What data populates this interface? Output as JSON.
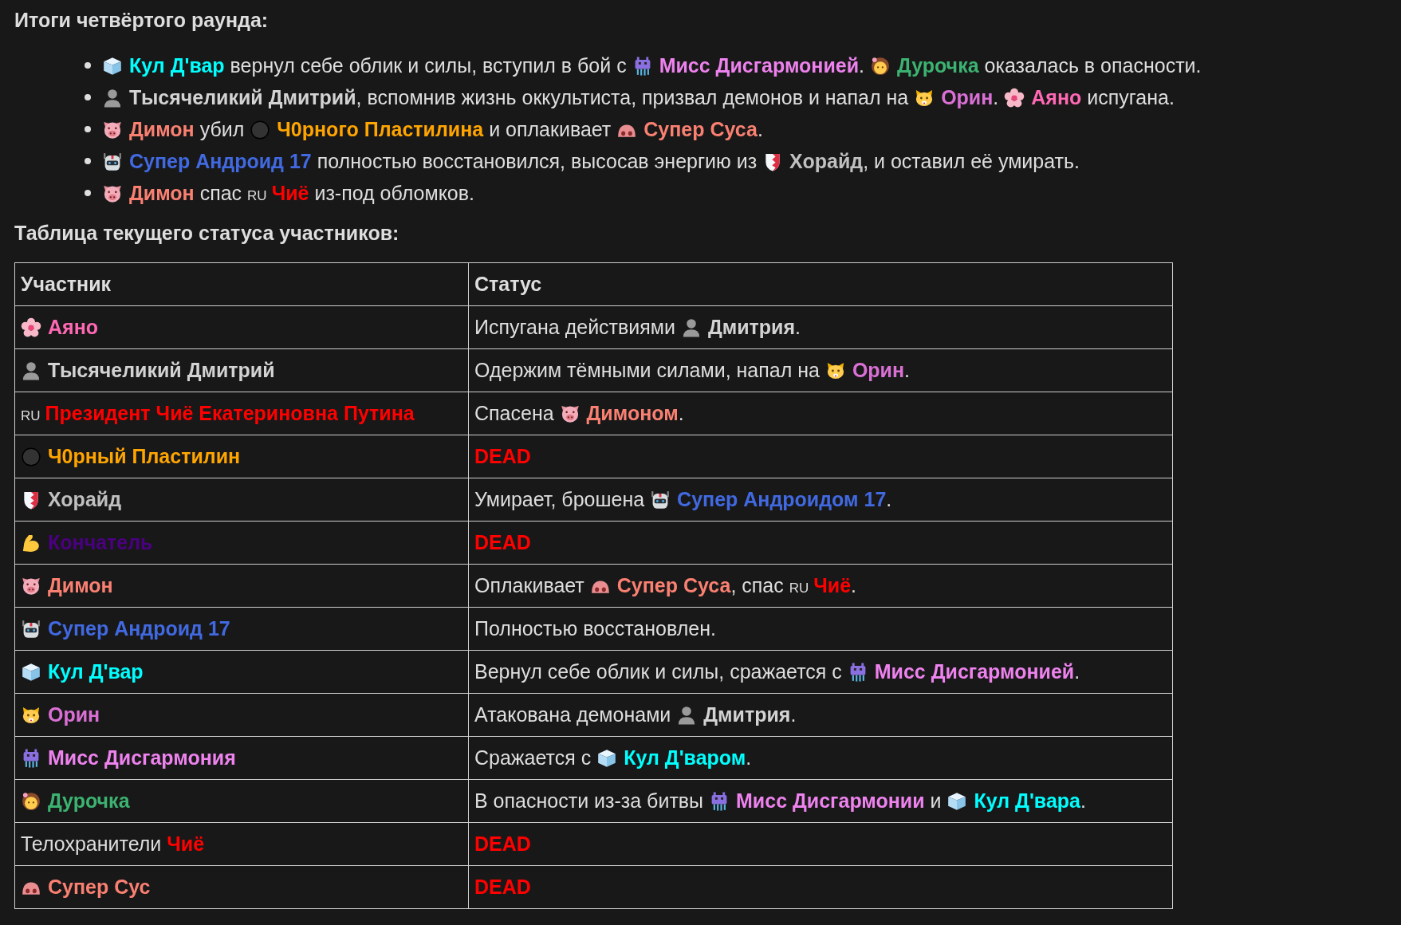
{
  "heading": "Итоги четвёртого раунда:",
  "summary": [
    {
      "segments": [
        {
          "kind": "ice"
        },
        {
          "kind": "name",
          "text": "Кул Д'вар",
          "color": "#00ffff"
        },
        {
          "kind": "text",
          "text": " вернул себе облик и силы, вступил в бой с "
        },
        {
          "kind": "monster"
        },
        {
          "kind": "name",
          "text": "Мисс Дисгармонией",
          "color": "#ee82ee"
        },
        {
          "kind": "text",
          "text": ". "
        },
        {
          "kind": "girl"
        },
        {
          "kind": "name",
          "text": "Дурочка",
          "color": "#3cb371"
        },
        {
          "kind": "text",
          "text": " оказалась в опасности."
        }
      ]
    },
    {
      "segments": [
        {
          "kind": "person"
        },
        {
          "kind": "name",
          "text": "Тысячеликий Дмитрий",
          "color": "#d3d3d3"
        },
        {
          "kind": "text",
          "text": ", вспомнив жизнь оккультиста, призвал демонов и напал на "
        },
        {
          "kind": "cat"
        },
        {
          "kind": "name",
          "text": "Орин",
          "color": "#da70d6"
        },
        {
          "kind": "text",
          "text": ". "
        },
        {
          "kind": "blossom"
        },
        {
          "kind": "name",
          "text": "Аяно",
          "color": "#ff69b4"
        },
        {
          "kind": "text",
          "text": " испугана."
        }
      ]
    },
    {
      "segments": [
        {
          "kind": "pig"
        },
        {
          "kind": "name",
          "text": "Димон",
          "color": "#fa8072"
        },
        {
          "kind": "text",
          "text": " убил "
        },
        {
          "kind": "circle"
        },
        {
          "kind": "name",
          "text": "Ч0рного Пластилина",
          "color": "#ffa500"
        },
        {
          "kind": "text",
          "text": " и оплакивает "
        },
        {
          "kind": "nose"
        },
        {
          "kind": "name",
          "text": "Супер Суса",
          "color": "#fa8072"
        },
        {
          "kind": "text",
          "text": "."
        }
      ]
    },
    {
      "segments": [
        {
          "kind": "robot"
        },
        {
          "kind": "name",
          "text": "Супер Андроид 17",
          "color": "#4169e1"
        },
        {
          "kind": "text",
          "text": " полностью восстановился, высосав энергию из "
        },
        {
          "kind": "shield"
        },
        {
          "kind": "name",
          "text": "Хорайд",
          "color": "#c0c0c0"
        },
        {
          "kind": "text",
          "text": ", и оставил её умирать."
        }
      ]
    },
    {
      "segments": [
        {
          "kind": "pig"
        },
        {
          "kind": "name",
          "text": "Димон",
          "color": "#fa8072"
        },
        {
          "kind": "text",
          "text": " спас "
        },
        {
          "kind": "flag",
          "text": "RU"
        },
        {
          "kind": "name",
          "text": "Чиё",
          "color": "#ff0000"
        },
        {
          "kind": "text",
          "text": " из-под обломков."
        }
      ]
    }
  ],
  "table_title": "Таблица текущего статуса участников:",
  "table": {
    "columns": [
      "Участник",
      "Статус"
    ],
    "rows": [
      {
        "participant": [
          {
            "kind": "blossom"
          },
          {
            "kind": "name",
            "text": "Аяно",
            "color": "#ff69b4"
          }
        ],
        "status": [
          {
            "kind": "text",
            "text": "Испугана действиями "
          },
          {
            "kind": "person"
          },
          {
            "kind": "name",
            "text": "Дмитрия",
            "color": "#d3d3d3"
          },
          {
            "kind": "text",
            "text": "."
          }
        ]
      },
      {
        "participant": [
          {
            "kind": "person"
          },
          {
            "kind": "name",
            "text": "Тысячеликий Дмитрий",
            "color": "#d3d3d3"
          }
        ],
        "status": [
          {
            "kind": "text",
            "text": "Одержим тёмными силами, напал на "
          },
          {
            "kind": "cat"
          },
          {
            "kind": "name",
            "text": "Орин",
            "color": "#da70d6"
          },
          {
            "kind": "text",
            "text": "."
          }
        ]
      },
      {
        "participant": [
          {
            "kind": "flag",
            "text": "RU"
          },
          {
            "kind": "name",
            "text": "Президент Чиё Екатериновна Путина",
            "color": "#ff0000"
          }
        ],
        "status": [
          {
            "kind": "text",
            "text": "Спасена "
          },
          {
            "kind": "pig"
          },
          {
            "kind": "name",
            "text": "Димоном",
            "color": "#fa8072"
          },
          {
            "kind": "text",
            "text": "."
          }
        ]
      },
      {
        "participant": [
          {
            "kind": "circle"
          },
          {
            "kind": "name",
            "text": "Ч0рный Пластилин",
            "color": "#ffa500"
          }
        ],
        "status": [
          {
            "kind": "name",
            "text": "DEAD",
            "color": "#ff0000"
          }
        ]
      },
      {
        "participant": [
          {
            "kind": "shield"
          },
          {
            "kind": "name",
            "text": "Хорайд",
            "color": "#c0c0c0"
          }
        ],
        "status": [
          {
            "kind": "text",
            "text": "Умирает, брошена "
          },
          {
            "kind": "robot"
          },
          {
            "kind": "name",
            "text": "Супер Андроидом 17",
            "color": "#4169e1"
          },
          {
            "kind": "text",
            "text": "."
          }
        ]
      },
      {
        "participant": [
          {
            "kind": "muscle"
          },
          {
            "kind": "name",
            "text": "Кончатель",
            "color": "#4b0082"
          }
        ],
        "status": [
          {
            "kind": "name",
            "text": "DEAD",
            "color": "#ff0000"
          }
        ]
      },
      {
        "participant": [
          {
            "kind": "pig"
          },
          {
            "kind": "name",
            "text": "Димон",
            "color": "#fa8072"
          }
        ],
        "status": [
          {
            "kind": "text",
            "text": "Оплакивает "
          },
          {
            "kind": "nose"
          },
          {
            "kind": "name",
            "text": "Супер Суса",
            "color": "#fa8072"
          },
          {
            "kind": "text",
            "text": ", спас "
          },
          {
            "kind": "flag",
            "text": "RU"
          },
          {
            "kind": "name",
            "text": "Чиё",
            "color": "#ff0000"
          },
          {
            "kind": "text",
            "text": "."
          }
        ]
      },
      {
        "participant": [
          {
            "kind": "robot"
          },
          {
            "kind": "name",
            "text": "Супер Андроид 17",
            "color": "#4169e1"
          }
        ],
        "status": [
          {
            "kind": "text",
            "text": "Полностью восстановлен."
          }
        ]
      },
      {
        "participant": [
          {
            "kind": "ice"
          },
          {
            "kind": "name",
            "text": "Кул Д'вар",
            "color": "#00ffff"
          }
        ],
        "status": [
          {
            "kind": "text",
            "text": "Вернул себе облик и силы, сражается с "
          },
          {
            "kind": "monster"
          },
          {
            "kind": "name",
            "text": "Мисс Дисгармонией",
            "color": "#ee82ee"
          },
          {
            "kind": "text",
            "text": "."
          }
        ]
      },
      {
        "participant": [
          {
            "kind": "cat"
          },
          {
            "kind": "name",
            "text": "Орин",
            "color": "#da70d6"
          }
        ],
        "status": [
          {
            "kind": "text",
            "text": "Атакована демонами "
          },
          {
            "kind": "person"
          },
          {
            "kind": "name",
            "text": "Дмитрия",
            "color": "#d3d3d3"
          },
          {
            "kind": "text",
            "text": "."
          }
        ]
      },
      {
        "participant": [
          {
            "kind": "monster"
          },
          {
            "kind": "name",
            "text": "Мисс Дисгармония",
            "color": "#ee82ee"
          }
        ],
        "status": [
          {
            "kind": "text",
            "text": "Сражается с "
          },
          {
            "kind": "ice"
          },
          {
            "kind": "name",
            "text": "Кул Д'варом",
            "color": "#00ffff"
          },
          {
            "kind": "text",
            "text": "."
          }
        ]
      },
      {
        "participant": [
          {
            "kind": "girl"
          },
          {
            "kind": "name",
            "text": "Дурочка",
            "color": "#3cb371"
          }
        ],
        "status": [
          {
            "kind": "text",
            "text": "В опасности из-за битвы "
          },
          {
            "kind": "monster"
          },
          {
            "kind": "name",
            "text": "Мисс Дисгармонии",
            "color": "#ee82ee"
          },
          {
            "kind": "text",
            "text": " и "
          },
          {
            "kind": "ice"
          },
          {
            "kind": "name",
            "text": "Кул Д'вара",
            "color": "#00ffff"
          },
          {
            "kind": "text",
            "text": "."
          }
        ]
      },
      {
        "participant": [
          {
            "kind": "text",
            "text": "Телохранители "
          },
          {
            "kind": "name",
            "text": "Чиё",
            "color": "#ff0000"
          }
        ],
        "status": [
          {
            "kind": "name",
            "text": "DEAD",
            "color": "#ff0000"
          }
        ]
      },
      {
        "participant": [
          {
            "kind": "nose"
          },
          {
            "kind": "name",
            "text": "Супер Сус",
            "color": "#fa8072"
          }
        ],
        "status": [
          {
            "kind": "name",
            "text": "DEAD",
            "color": "#ff0000"
          }
        ]
      }
    ]
  }
}
